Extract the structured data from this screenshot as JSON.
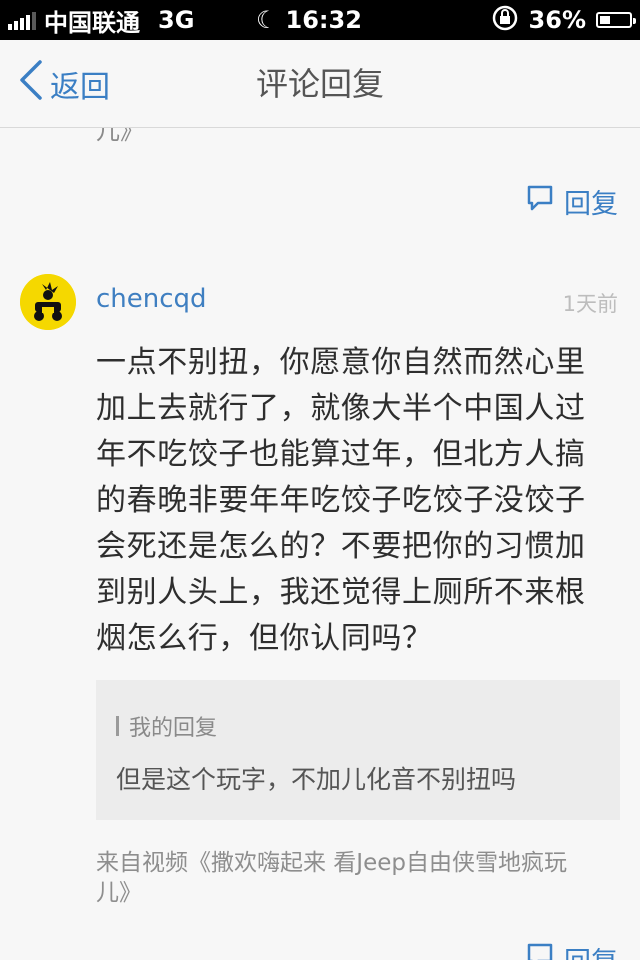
{
  "status_bar": {
    "carrier": "中国联通",
    "network": "3G",
    "time": "16:32",
    "battery": "36%",
    "battery_level": 0.36
  },
  "nav": {
    "back_label": "返回",
    "title": "评论回复"
  },
  "prev_comment_tail": "儿》",
  "reply_label": "回复",
  "comment": {
    "username": "chencqd",
    "time": "1天前",
    "lines": [
      "一点不别扭，你愿意你自然而然心里",
      "加上去就行了，就像大半个中国人过",
      "年不吃饺子也能算过年，但北方人搞",
      "的春晚非要年年吃饺子吃饺子没饺子",
      "会死还是怎么的？不要把你的习惯加",
      "到别人头上，我还觉得上厕所不来根",
      "烟怎么行，但你认同吗？"
    ],
    "quote_label": "我的回复",
    "quote_text": "但是这个玩字，不加儿化音不别扭吗",
    "source_line1": "来自视频《撒欢嗨起来 看Jeep自由侠雪地疯玩",
    "source_line2": "儿》"
  },
  "colors": {
    "accent": "#3b7fc4",
    "avatar_bg": "#f5d800"
  }
}
